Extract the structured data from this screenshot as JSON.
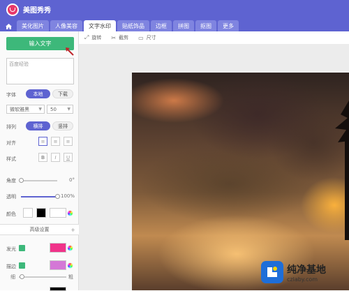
{
  "app": {
    "title": "美图秀秀"
  },
  "tabs": [
    "美化图片",
    "人像美容",
    "文字水印",
    "贴纸饰品",
    "边框",
    "拼图",
    "抠图",
    "更多"
  ],
  "active_tab": 2,
  "toolbar": {
    "rotate": "旋转",
    "crop": "截剪",
    "size": "尺寸"
  },
  "sidebar": {
    "input_button": "输入文字",
    "textarea_value": "百度经验",
    "font_label": "字体",
    "font_local": "本地",
    "font_download": "下载",
    "font_family_value": "微软雅黑",
    "font_size_value": "50",
    "arrange_label": "排列",
    "arrange_horizontal": "横排",
    "arrange_vertical": "竖排",
    "align_label": "对齐",
    "style_label": "样式",
    "style_bold": "B",
    "style_italic": "I",
    "style_underline": "U",
    "angle_label": "角度",
    "angle_value": "0°",
    "angle_level": 0,
    "opacity_label": "透明",
    "opacity_value": "100%",
    "opacity_level": 1,
    "color_label": "颜色",
    "advanced": "高级设置",
    "glow_label": "发光",
    "stroke_label": "描边",
    "thin": "细",
    "thick": "粗",
    "colors": {
      "accent": "#5e63d1",
      "green": "#3db87a",
      "glow": "#f0338a",
      "stroke": "#d478d6",
      "text": "#000000"
    }
  },
  "watermark": {
    "title": "纯净基地",
    "url": "czlaby.com"
  }
}
